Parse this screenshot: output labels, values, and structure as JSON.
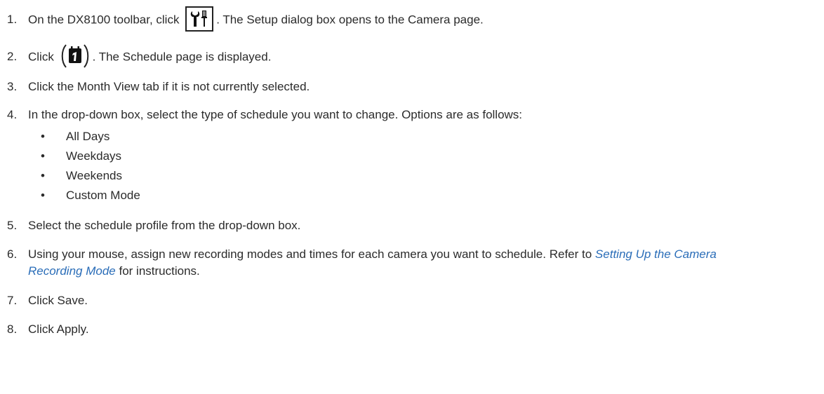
{
  "steps": [
    {
      "num": "1.",
      "before": "On the DX8100 toolbar, click",
      "after": ". The Setup dialog box opens to the Camera page.",
      "icon": "setup-tools-icon"
    },
    {
      "num": "2.",
      "before": "Click",
      "after": ". The Schedule page is displayed.",
      "icon": "schedule-calendar-icon"
    },
    {
      "num": "3.",
      "text": "Click the Month View tab if it is not currently selected."
    },
    {
      "num": "4.",
      "text": "In the drop-down box, select the type of schedule you want to change. Options are as follows:"
    },
    {
      "num": "5.",
      "text": "Select the schedule profile from the drop-down box."
    },
    {
      "num": "6.",
      "before": "Using your mouse, assign new recording modes and times for each camera you want to schedule. Refer to",
      "link1": "Setting Up the Camera",
      "link2": "Recording Mode",
      "after": "for instructions."
    },
    {
      "num": "7.",
      "text": "Click Save."
    },
    {
      "num": "8.",
      "text": "Click Apply."
    }
  ],
  "options": [
    "All Days",
    "Weekdays",
    "Weekends",
    "Custom Mode"
  ],
  "bullet_char": "•",
  "colors": {
    "text": "#2b2b2b",
    "link": "#2a6db8"
  }
}
